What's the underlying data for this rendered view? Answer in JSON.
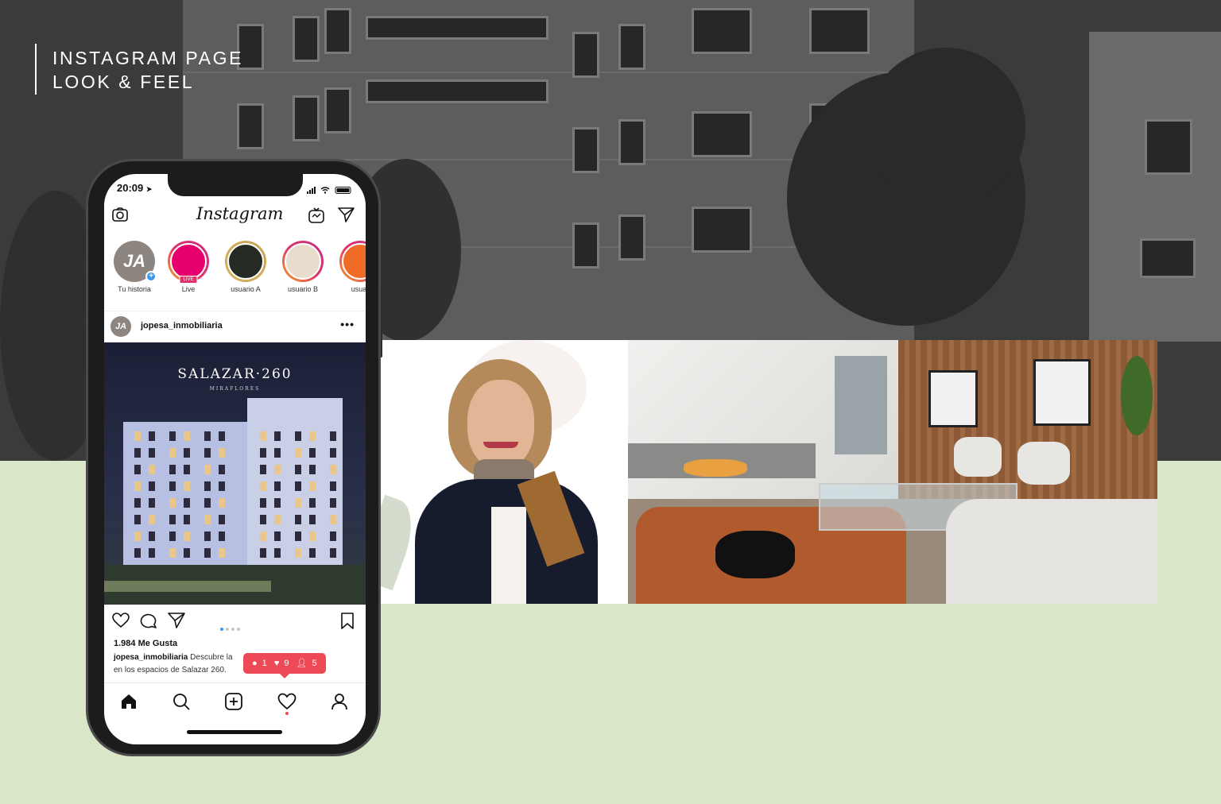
{
  "header": {
    "line1": "INSTAGRAM PAGE",
    "line2": "LOOK & FEEL"
  },
  "colors": {
    "top_background": "#3b3b3b",
    "bottom_background": "#d9e6c8",
    "notification": "#ed4956",
    "accent_blue": "#3897f0"
  },
  "phone": {
    "status": {
      "time": "20:09"
    },
    "app": {
      "logo": "Instagram"
    },
    "stories": [
      {
        "initials": "JA",
        "label": "Tu historia"
      },
      {
        "label": "Live",
        "badge": "LIVE"
      },
      {
        "label": "usuario A"
      },
      {
        "label": "usuario B"
      },
      {
        "label": "usuar"
      }
    ],
    "post": {
      "avatar": "JA",
      "username": "jopesa_inmobiliaria",
      "more": "•••",
      "image_title": "SALAZAR·260",
      "image_subtitle": "MIRAFLORES",
      "likes": "1.984 Me Gusta",
      "caption_user": "jopesa_inmobiliaria",
      "caption_text": "Descubre la",
      "caption_line2": "en los espacios de Salazar 260."
    },
    "notification": {
      "comments": "1",
      "likes": "9",
      "follows": "5"
    }
  },
  "icons": [
    "camera-icon",
    "igtv-icon",
    "direct-icon",
    "heart-icon",
    "comment-icon",
    "share-icon",
    "bookmark-icon",
    "home-icon",
    "search-icon",
    "add-icon",
    "activity-icon",
    "profile-icon"
  ]
}
